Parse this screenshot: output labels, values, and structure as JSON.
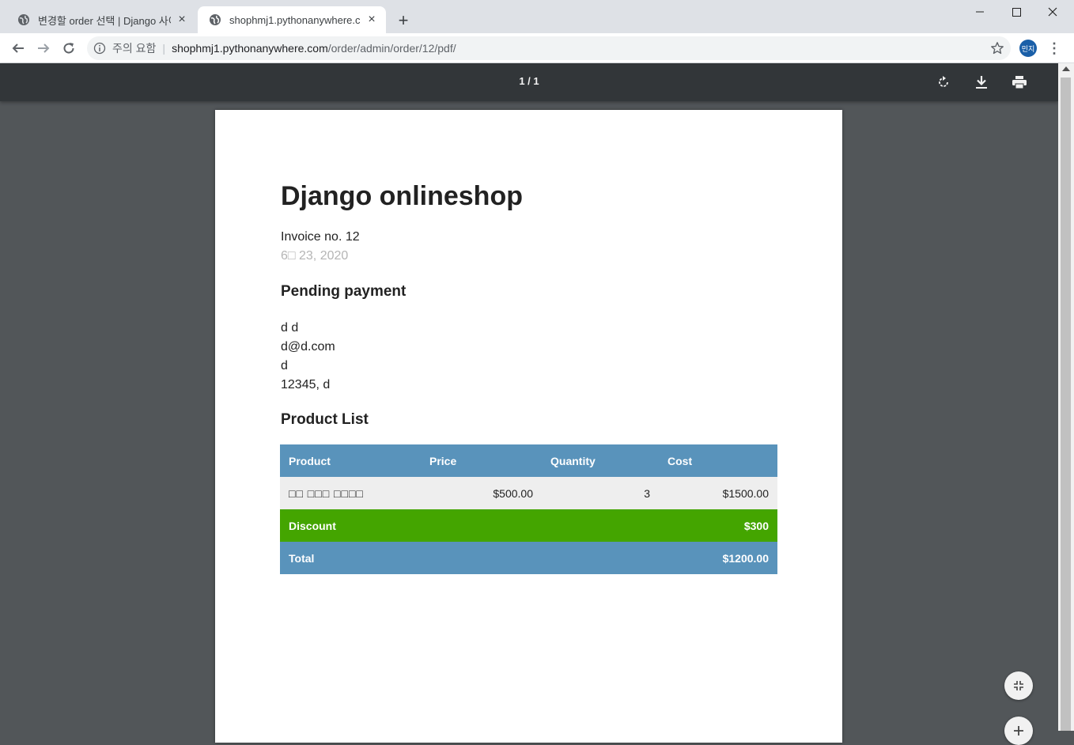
{
  "browser": {
    "tabs": [
      {
        "title": "변경할 order 선택 | Django 사이",
        "active": false
      },
      {
        "title": "shophmj1.pythonanywhere.com/order/admin/order/12/pdf/",
        "active": true
      }
    ],
    "new_tab_label": "+",
    "address": {
      "security_label": "주의 요함",
      "host": "shophmj1.pythonanywhere.com",
      "path": "/order/admin/order/12/pdf/"
    },
    "profile_initials": "민지"
  },
  "pdf_viewer": {
    "page_counter": "1 / 1"
  },
  "document": {
    "title": "Django onlineshop",
    "invoice_label": "Invoice no. 12",
    "date": "6□ 23, 2020",
    "status": "Pending payment",
    "address_lines": [
      "d d",
      "d@d.com",
      "d",
      "12345, d"
    ],
    "product_list_heading": "Product List",
    "table": {
      "headers": [
        "Product",
        "Price",
        "Quantity",
        "Cost"
      ],
      "rows": [
        {
          "product": "□□ □□□ □□□□",
          "price": "$500.00",
          "quantity": "3",
          "cost": "$1500.00"
        }
      ],
      "discount_label": "Discount",
      "discount_value": "$300",
      "total_label": "Total",
      "total_value": "$1200.00"
    }
  },
  "colors": {
    "header_blue": "#5993bb",
    "discount_green": "#44a500",
    "viewer_bg": "#525659",
    "toolbar_dark": "#323639"
  }
}
